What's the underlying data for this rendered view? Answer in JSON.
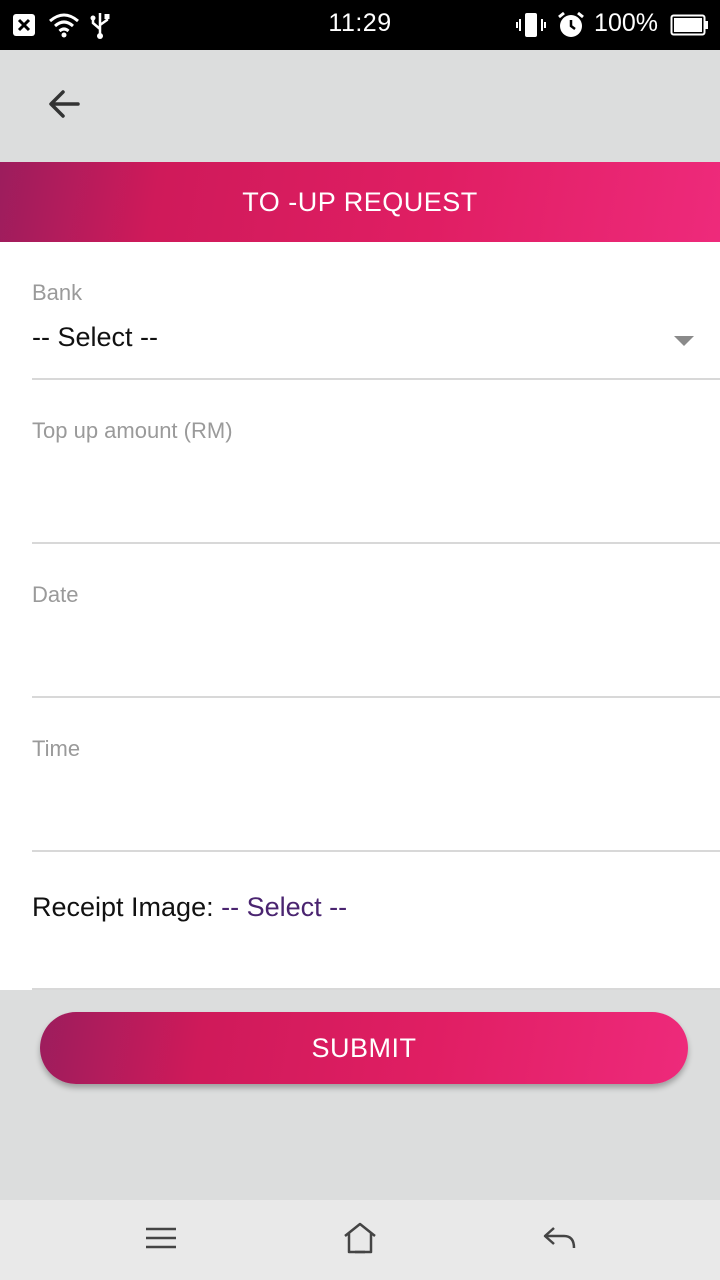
{
  "status_bar": {
    "time": "11:29",
    "battery_percent": "100%",
    "icons": [
      "close-notification-icon",
      "wifi-icon",
      "usb-icon",
      "vibrate-icon",
      "alarm-icon",
      "battery-icon"
    ]
  },
  "app_bar": {
    "back_icon": "arrow-left-icon"
  },
  "header": {
    "title": "TO -UP REQUEST",
    "gradient_colors": [
      "#9c1d5d",
      "#e01e63",
      "#ee2a7b"
    ]
  },
  "form": {
    "bank": {
      "label": "Bank",
      "value": "-- Select --"
    },
    "amount": {
      "label": "Top up amount (RM)",
      "value": ""
    },
    "date": {
      "label": "Date",
      "value": ""
    },
    "time": {
      "label": "Time",
      "value": ""
    },
    "receipt": {
      "label": "Receipt Image:",
      "select_text": "-- Select --",
      "select_color": "#4a2470"
    }
  },
  "submit": {
    "label": "SUBMIT"
  },
  "nav_bar": {
    "icons": [
      "menu-icon",
      "home-icon",
      "back-icon"
    ]
  }
}
